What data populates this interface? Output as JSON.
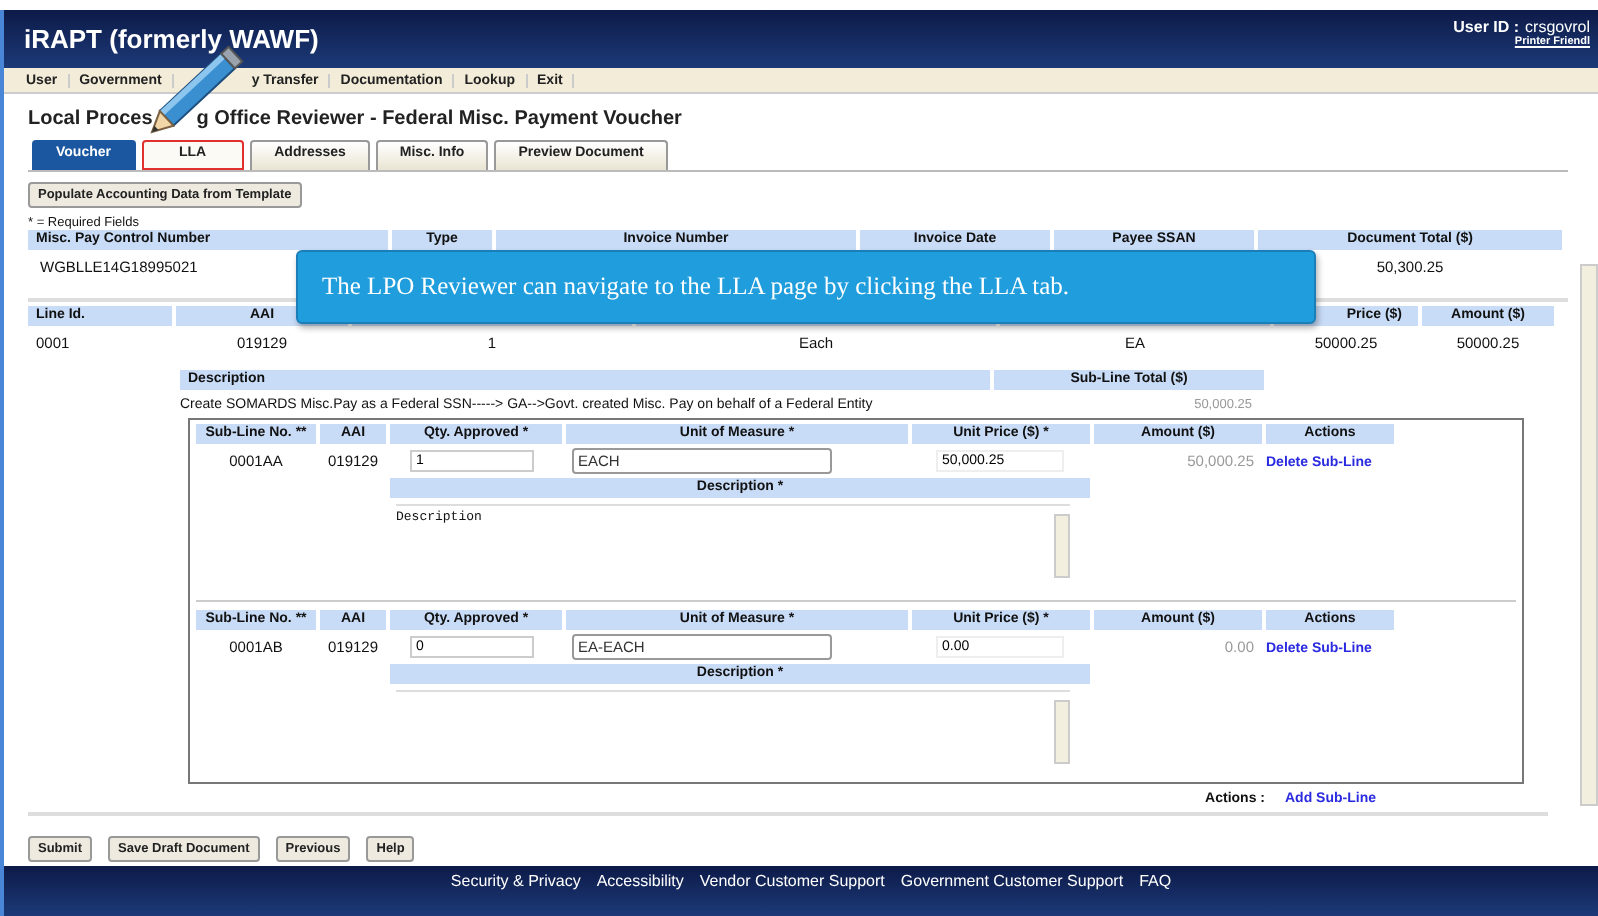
{
  "header": {
    "app_title": "iRAPT (formerly WAWF)",
    "user_id_label": "User ID :",
    "user_id": "crsgovrol",
    "printer_link": "Printer Friendl"
  },
  "menu": [
    "User",
    "Government",
    "y Transfer",
    "Documentation",
    "Lookup",
    "Exit"
  ],
  "page_title_parts": [
    "Local Proces",
    "g Office Reviewer - Federal Misc. Payment Voucher"
  ],
  "tabs": [
    {
      "label": "Voucher",
      "selected": true,
      "highlighted": false
    },
    {
      "label": "LLA",
      "selected": false,
      "highlighted": true
    },
    {
      "label": "Addresses",
      "selected": false,
      "highlighted": false
    },
    {
      "label": "Misc. Info",
      "selected": false,
      "highlighted": false
    },
    {
      "label": "Preview Document",
      "selected": false,
      "highlighted": false
    }
  ],
  "populate_button": "Populate Accounting Data from Template",
  "required_note": "* = Required Fields",
  "summary": {
    "columns": [
      "Misc. Pay Control Number",
      "Type",
      "Invoice Number",
      "Invoice Date",
      "Payee SSAN",
      "Document Total ($)"
    ],
    "control_number": "WGBLLE14G18995021",
    "document_total": "50,300.25"
  },
  "line_table": {
    "headers_left": [
      "Line Id.",
      "AAI"
    ],
    "headers_right": [
      "Price ($)",
      "Amount ($)"
    ],
    "row": [
      "0001",
      "019129",
      "1",
      "Each",
      "EA",
      "50000.25",
      "50000.25"
    ],
    "description_label": "Description",
    "sub_line_total_label": "Sub-Line Total ($)",
    "description": "Create SOMARDS Misc.Pay as a Federal SSN-----> GA-->Govt. created Misc. Pay on behalf of a Federal Entity",
    "sub_line_total": "50,000.25"
  },
  "sub_lines": {
    "items": [
      {
        "columns": [
          "Sub-Line No. **",
          "AAI",
          "Qty. Approved *",
          "Unit of Measure *",
          "Unit Price ($) *",
          "Amount ($)",
          "Actions"
        ],
        "description_label": "Description *",
        "number": "0001AA",
        "aai": "019129",
        "qty": "1",
        "unit": "EACH",
        "unit_price": "50,000.25",
        "amount": "50,000.25",
        "action": "Delete Sub-Line",
        "description": "Description"
      },
      {
        "columns": [
          "Sub-Line No. **",
          "AAI",
          "Qty. Approved *",
          "Unit of Measure *",
          "Unit Price ($) *",
          "Amount ($)",
          "Actions"
        ],
        "description_label": "Description *",
        "number": "0001AB",
        "aai": "019129",
        "qty": "0",
        "unit": "EA-EACH",
        "unit_price": "0.00",
        "amount": "0.00",
        "action": "Delete Sub-Line"
      }
    ],
    "actions_label": "Actions :",
    "add_link": "Add Sub-Line"
  },
  "buttons": [
    "Submit",
    "Save Draft Document",
    "Previous",
    "Help"
  ],
  "footer_links": [
    "Security & Privacy",
    "Accessibility",
    "Vendor Customer Support",
    "Government Customer Support",
    "FAQ"
  ],
  "callout": {
    "text": "The LPO Reviewer can navigate to the LLA page by clicking the LLA tab."
  }
}
